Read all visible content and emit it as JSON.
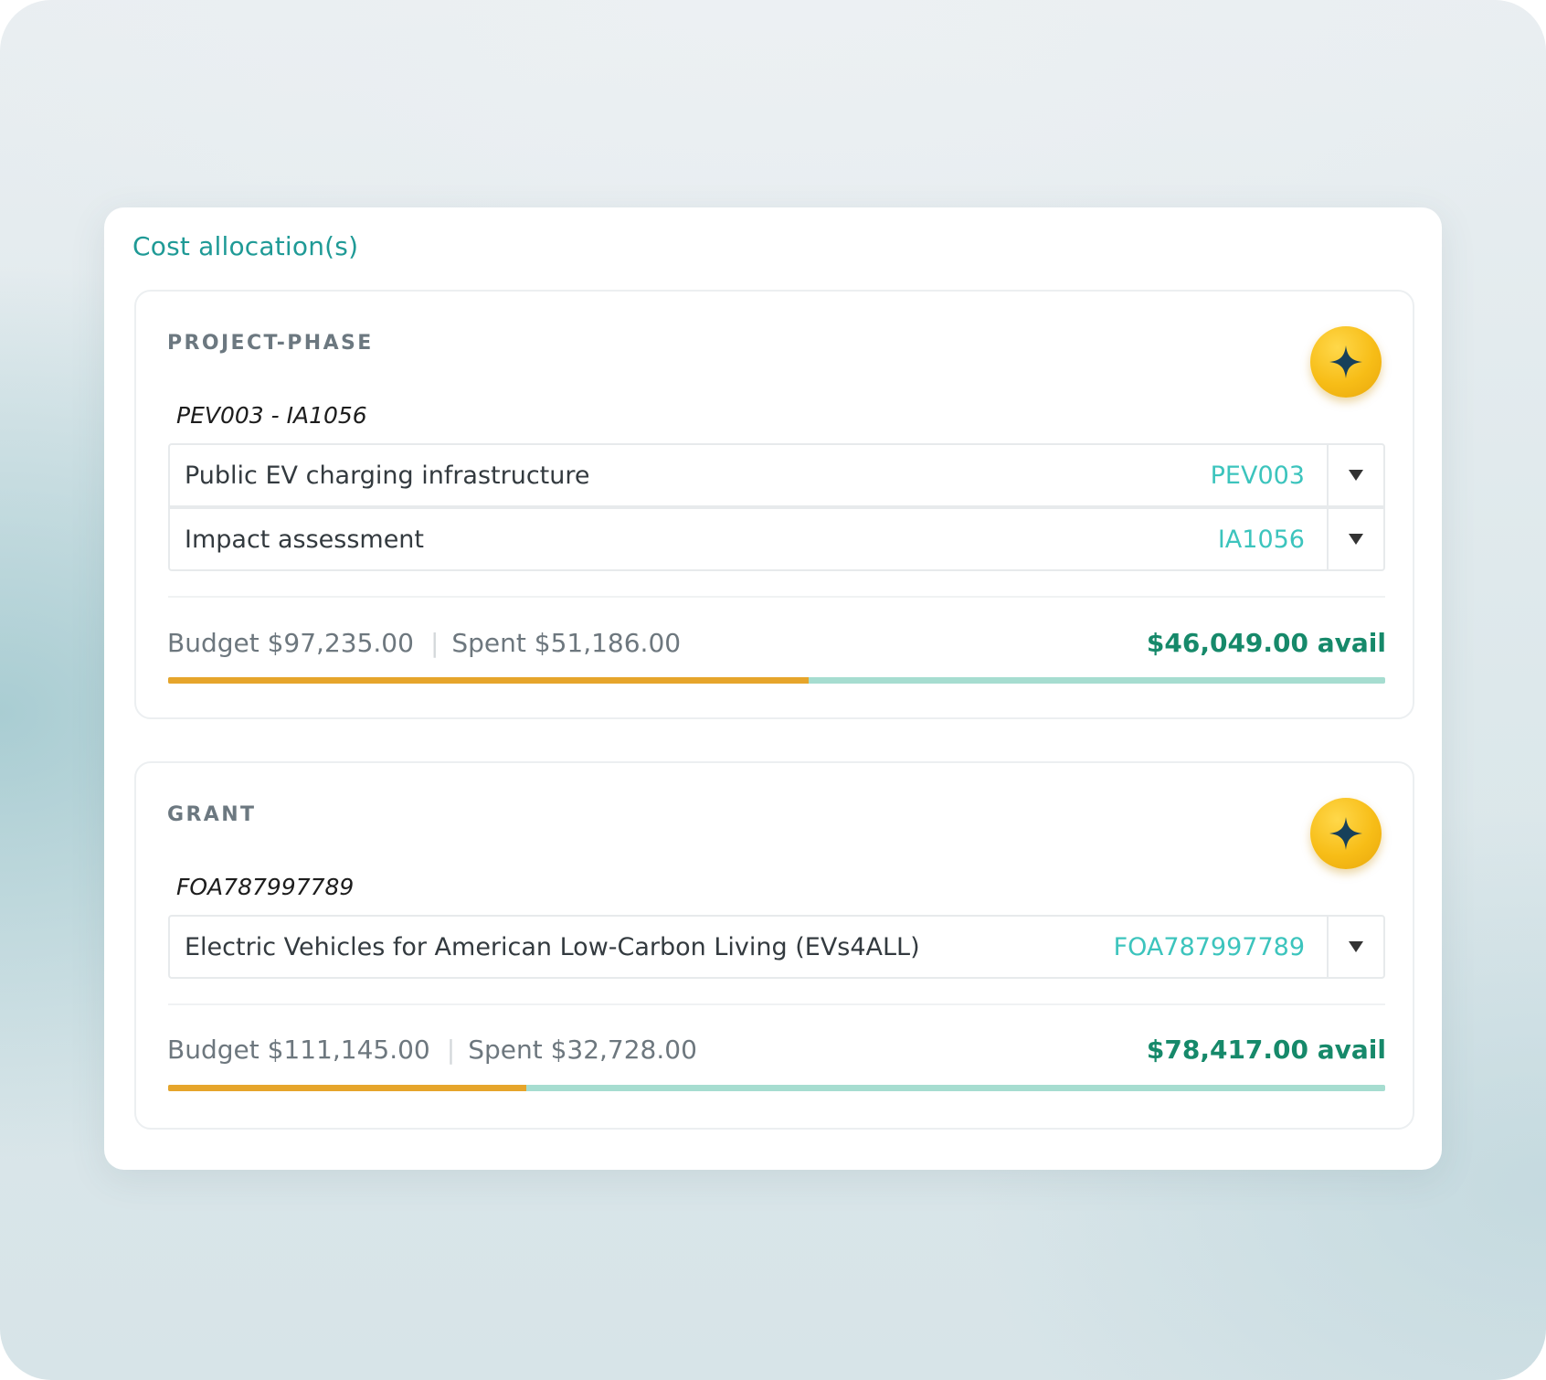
{
  "panel": {
    "title": "Cost allocation(s)"
  },
  "allocations": [
    {
      "section_label": "PROJECT-PHASE",
      "ai_icon": "sparkle-icon",
      "selection_title": "PEV003 - IA1056",
      "selects": [
        {
          "label": "Public EV charging infrastructure",
          "code": "PEV003"
        },
        {
          "label": "Impact assessment",
          "code": "IA1056"
        }
      ],
      "budget_text": "Budget $97,235.00",
      "spent_text": "Spent $51,186.00",
      "avail_text": "$46,049.00 avail",
      "spent_fraction": 0.5264
    },
    {
      "section_label": "GRANT",
      "ai_icon": "sparkle-icon",
      "selection_title": "FOA787997789",
      "selects": [
        {
          "label": "Electric Vehicles for American Low-Carbon Living (EVs4ALL)",
          "code": "FOA787997789"
        }
      ],
      "budget_text": "Budget $111,145.00",
      "spent_text": "Spent $32,728.00",
      "avail_text": "$78,417.00 avail",
      "spent_fraction": 0.2945
    }
  ],
  "colors": {
    "accent_teal": "#1f9a96",
    "code_teal": "#3cc4bd",
    "avail_green": "#16896a",
    "spent_orange": "#e6a52b",
    "remaining_mint": "#a6ddd0",
    "ai_button_yellow": "#f7bd17"
  }
}
